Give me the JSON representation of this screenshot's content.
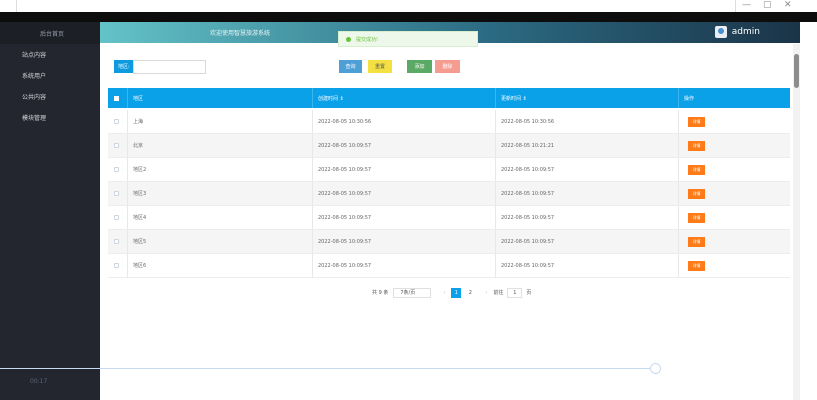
{
  "window": {
    "controls": [
      "—",
      "▢",
      "✕"
    ]
  },
  "sidebar": {
    "header": "后台首页",
    "items": [
      "站点内容",
      "系统用户",
      "公共内容",
      "模块管理"
    ]
  },
  "header": {
    "welcome": "欢迎使用智慧旅游系统",
    "username": "admin"
  },
  "toast": {
    "message": "提交成功!"
  },
  "filter": {
    "label": "地区:",
    "value": "",
    "placeholder": ""
  },
  "buttons": {
    "search": "查询",
    "reset": "重置",
    "add": "添加",
    "delete": "删除"
  },
  "colors": {
    "primary": "#0aa1e8",
    "search": "#4d9fd6",
    "reset": "#f4e043",
    "add": "#5aa964",
    "delete": "#f69b8f",
    "detail": "#ff7a18",
    "sidebar_bg": "#23262e"
  },
  "table": {
    "columns": [
      "地区",
      "创建时间 ⇕",
      "更新时间 ⇕",
      "操作"
    ],
    "rows": [
      [
        "上海",
        "2022-08-05 10:30:56",
        "2022-08-05 10:30:56",
        "详情"
      ],
      [
        "北京",
        "2022-08-05 10:09:57",
        "2022-08-05 10:21:21",
        "详情"
      ],
      [
        "地区2",
        "2022-08-05 10:09:57",
        "2022-08-05 10:09:57",
        "详情"
      ],
      [
        "地区3",
        "2022-08-05 10:09:57",
        "2022-08-05 10:09:57",
        "详情"
      ],
      [
        "地区4",
        "2022-08-05 10:09:57",
        "2022-08-05 10:09:57",
        "详情"
      ],
      [
        "地区5",
        "2022-08-05 10:09:57",
        "2022-08-05 10:09:57",
        "详情"
      ],
      [
        "地区6",
        "2022-08-05 10:09:57",
        "2022-08-05 10:09:57",
        "详情"
      ]
    ]
  },
  "pagination": {
    "total": "共 9 条",
    "page_size": "7条/页",
    "prev": "‹",
    "pages": [
      "1",
      "2"
    ],
    "next": "›",
    "goto_label": "前往",
    "goto_value": "1",
    "page_suffix": "页"
  },
  "video": {
    "time": "00:17"
  }
}
